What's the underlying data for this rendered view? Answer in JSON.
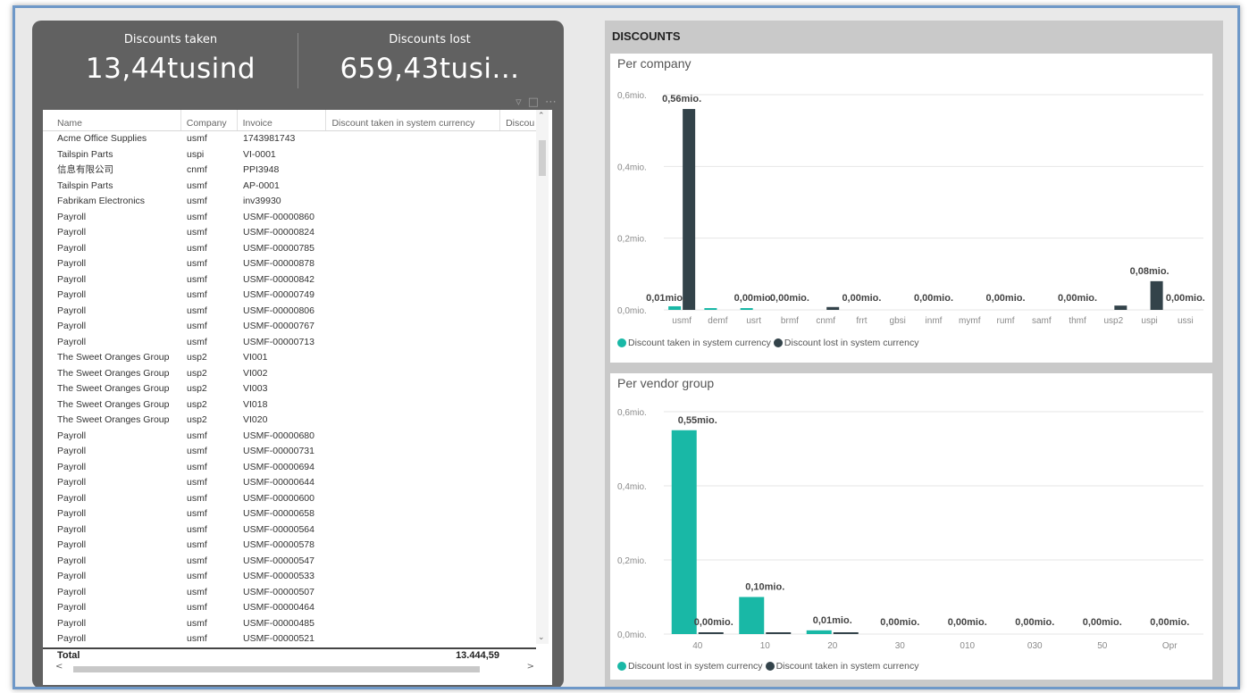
{
  "kpis": {
    "taken_label": "Discounts taken",
    "taken_value": "13,44tusind",
    "lost_label": "Discounts lost",
    "lost_value": "659,43tusi..."
  },
  "table": {
    "columns": [
      "Name",
      "Company",
      "Invoice",
      "Discount taken in system currency",
      "Discou"
    ],
    "rows": [
      [
        "Acme Office Supplies",
        "usmf",
        "1743981743"
      ],
      [
        "Tailspin Parts",
        "uspi",
        "VI-0001"
      ],
      [
        "信息有限公司",
        "cnmf",
        "PPI3948"
      ],
      [
        "Tailspin Parts",
        "usmf",
        "AP-0001"
      ],
      [
        "Fabrikam Electronics",
        "usmf",
        "inv39930"
      ],
      [
        "Payroll",
        "usmf",
        "USMF-00000860"
      ],
      [
        "Payroll",
        "usmf",
        "USMF-00000824"
      ],
      [
        "Payroll",
        "usmf",
        "USMF-00000785"
      ],
      [
        "Payroll",
        "usmf",
        "USMF-00000878"
      ],
      [
        "Payroll",
        "usmf",
        "USMF-00000842"
      ],
      [
        "Payroll",
        "usmf",
        "USMF-00000749"
      ],
      [
        "Payroll",
        "usmf",
        "USMF-00000806"
      ],
      [
        "Payroll",
        "usmf",
        "USMF-00000767"
      ],
      [
        "Payroll",
        "usmf",
        "USMF-00000713"
      ],
      [
        "The Sweet Oranges Group",
        "usp2",
        "VI001"
      ],
      [
        "The Sweet Oranges Group",
        "usp2",
        "VI002"
      ],
      [
        "The Sweet Oranges Group",
        "usp2",
        "VI003"
      ],
      [
        "The Sweet Oranges Group",
        "usp2",
        "VI018"
      ],
      [
        "The Sweet Oranges Group",
        "usp2",
        "VI020"
      ],
      [
        "Payroll",
        "usmf",
        "USMF-00000680"
      ],
      [
        "Payroll",
        "usmf",
        "USMF-00000731"
      ],
      [
        "Payroll",
        "usmf",
        "USMF-00000694"
      ],
      [
        "Payroll",
        "usmf",
        "USMF-00000644"
      ],
      [
        "Payroll",
        "usmf",
        "USMF-00000600"
      ],
      [
        "Payroll",
        "usmf",
        "USMF-00000658"
      ],
      [
        "Payroll",
        "usmf",
        "USMF-00000564"
      ],
      [
        "Payroll",
        "usmf",
        "USMF-00000578"
      ],
      [
        "Payroll",
        "usmf",
        "USMF-00000547"
      ],
      [
        "Payroll",
        "usmf",
        "USMF-00000533"
      ],
      [
        "Payroll",
        "usmf",
        "USMF-00000507"
      ],
      [
        "Payroll",
        "usmf",
        "USMF-00000464"
      ],
      [
        "Payroll",
        "usmf",
        "USMF-00000485"
      ],
      [
        "Payroll",
        "usmf",
        "USMF-00000521"
      ]
    ],
    "total_label": "Total",
    "total_value": "13.444,59"
  },
  "section_title": "DISCOUNTS",
  "colors": {
    "teal": "#19b8a6",
    "dark": "#33434a",
    "grid": "#e6e6e6",
    "axis_text": "#8a8a8a",
    "label_text": "#444444"
  },
  "chart_data": [
    {
      "type": "bar",
      "title": "Per company",
      "categories": [
        "usmf",
        "demf",
        "usrt",
        "brmf",
        "cnmf",
        "frrt",
        "gbsi",
        "inmf",
        "mymf",
        "rumf",
        "samf",
        "thmf",
        "usp2",
        "uspi",
        "ussi"
      ],
      "series": [
        {
          "name": "Discount taken in system currency",
          "color": "#19b8a6",
          "values": [
            0.01,
            0.002,
            0.001,
            0.0,
            0.0,
            0.0,
            0.0,
            0.0,
            0.0,
            0.0,
            0.0,
            0.0,
            0.0,
            0.0,
            0.0
          ]
        },
        {
          "name": "Discount lost in system currency",
          "color": "#33434a",
          "values": [
            0.56,
            0.0,
            0.0,
            0.0,
            0.008,
            0.0,
            0.0,
            0.0,
            0.0,
            0.0,
            0.0,
            0.0,
            0.012,
            0.08,
            0.0
          ]
        }
      ],
      "data_labels": [
        {
          "category": "usmf",
          "text": "0,56mio."
        },
        {
          "category": "usmf",
          "text": "0,01mio."
        },
        {
          "category": "usrt",
          "text": "0,00mio."
        },
        {
          "category": "brmf",
          "text": "0,00mio."
        },
        {
          "category": "frrt",
          "text": "0,00mio."
        },
        {
          "category": "inmf",
          "text": "0,00mio."
        },
        {
          "category": "rumf",
          "text": "0,00mio."
        },
        {
          "category": "thmf",
          "text": "0,00mio."
        },
        {
          "category": "uspi",
          "text": "0,08mio."
        },
        {
          "category": "ussi",
          "text": "0,00mio."
        }
      ],
      "y_ticks": [
        "0,0mio.",
        "0,2mio.",
        "0,4mio.",
        "0,6mio."
      ],
      "ylim": [
        0,
        0.6
      ],
      "legend": [
        "Discount taken in system currency",
        "Discount lost in system currency"
      ]
    },
    {
      "type": "bar",
      "title": "Per vendor group",
      "categories": [
        "40",
        "10",
        "20",
        "30",
        "010",
        "030",
        "50",
        "Opr"
      ],
      "series": [
        {
          "name": "Discount lost in system currency",
          "color": "#19b8a6",
          "values": [
            0.55,
            0.1,
            0.01,
            0.0,
            0.0,
            0.0,
            0.0,
            0.0
          ]
        },
        {
          "name": "Discount taken in system currency",
          "color": "#33434a",
          "values": [
            0.003,
            0.004,
            0.002,
            0.0,
            0.0,
            0.0,
            0.0,
            0.0
          ]
        }
      ],
      "data_labels": [
        {
          "category": "40",
          "text": "0,55mio."
        },
        {
          "category": "40",
          "text": "0,00mio."
        },
        {
          "category": "10",
          "text": "0,10mio."
        },
        {
          "category": "20",
          "text": "0,01mio."
        },
        {
          "category": "30",
          "text": "0,00mio."
        },
        {
          "category": "010",
          "text": "0,00mio."
        },
        {
          "category": "030",
          "text": "0,00mio."
        },
        {
          "category": "50",
          "text": "0,00mio."
        },
        {
          "category": "Opr",
          "text": "0,00mio."
        }
      ],
      "y_ticks": [
        "0,0mio.",
        "0,2mio.",
        "0,4mio.",
        "0,6mio."
      ],
      "ylim": [
        0,
        0.6
      ],
      "legend": [
        "Discount lost in system currency",
        "Discount taken in system currency"
      ]
    }
  ]
}
